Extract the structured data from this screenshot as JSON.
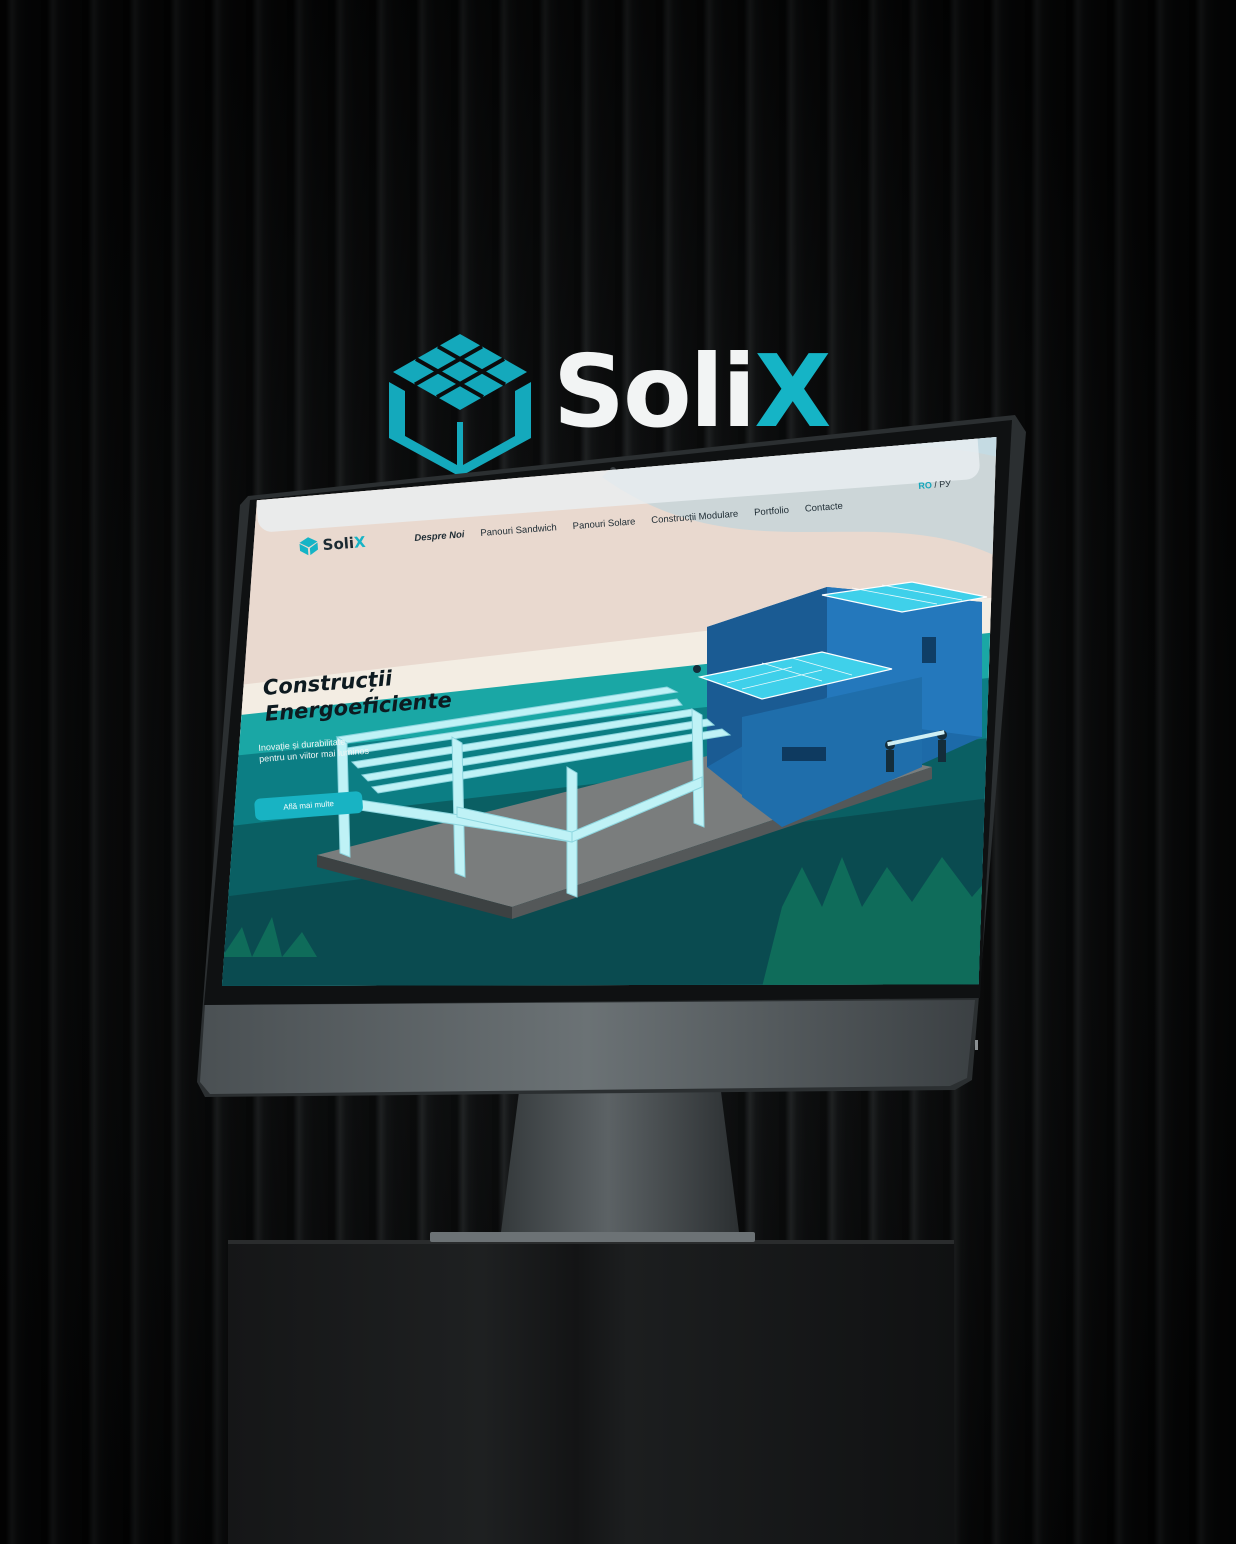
{
  "brand": {
    "name_main": "Soli",
    "name_accent": "X"
  },
  "site": {
    "logo": {
      "main": "Soli",
      "accent": "X"
    },
    "nav": [
      {
        "label": "Despre Noi",
        "active": true
      },
      {
        "label": "Panouri Sandwich",
        "active": false
      },
      {
        "label": "Panouri Solare",
        "active": false
      },
      {
        "label": "Construcții Modulare",
        "active": false
      },
      {
        "label": "Portfolio",
        "active": false
      },
      {
        "label": "Contacte",
        "active": false
      }
    ],
    "lang": {
      "ro": "RO",
      "sep": " / ",
      "ru": "РУ"
    },
    "hero": {
      "title_line1": "Construcții",
      "title_line2": "Energoeficiente",
      "subtitle_line1": "Inovație și durabilitate",
      "subtitle_line2": "pentru un viitor mai luminos",
      "cta": "Află mai multe"
    }
  },
  "colors": {
    "accent": "#15b4c6",
    "dark": "#0d1a20",
    "background": "#0b0c0d"
  }
}
